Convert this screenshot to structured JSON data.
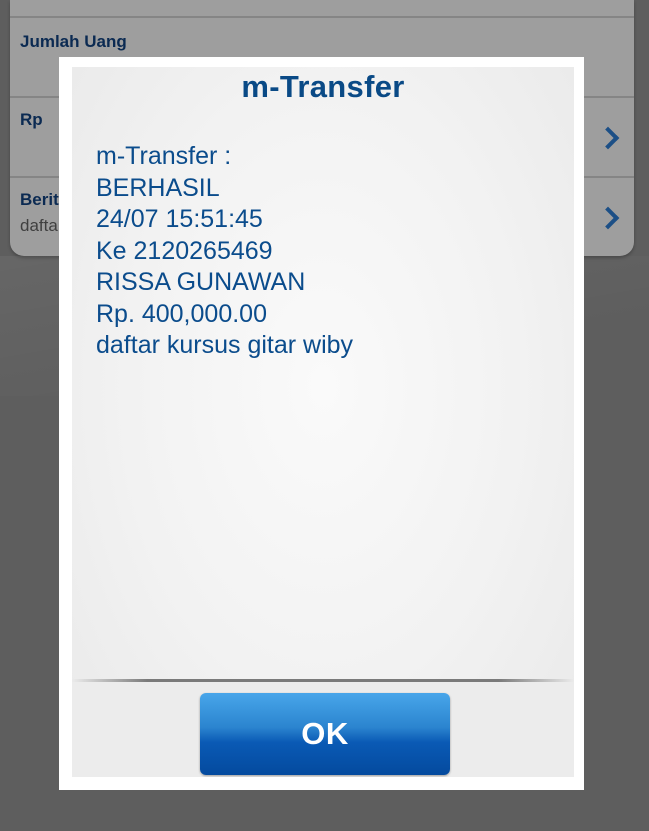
{
  "background_form": {
    "amount_label": "Jumlah Uang",
    "currency_label": "Rp",
    "message_label": "Berit",
    "message_value": "dafta"
  },
  "dialog": {
    "title": "m-Transfer",
    "message_lines": [
      "m-Transfer :",
      "BERHASIL",
      "24/07 15:51:45",
      "Ke 2120265469",
      "RISSA GUNAWAN",
      "Rp. 400,000.00",
      "daftar kursus gitar wiby"
    ],
    "ok_label": "OK"
  },
  "colors": {
    "title_blue": "#0a4a86",
    "text_blue": "#0b4c8c",
    "button_top": "#48a6ea",
    "button_bottom": "#044a9e"
  }
}
